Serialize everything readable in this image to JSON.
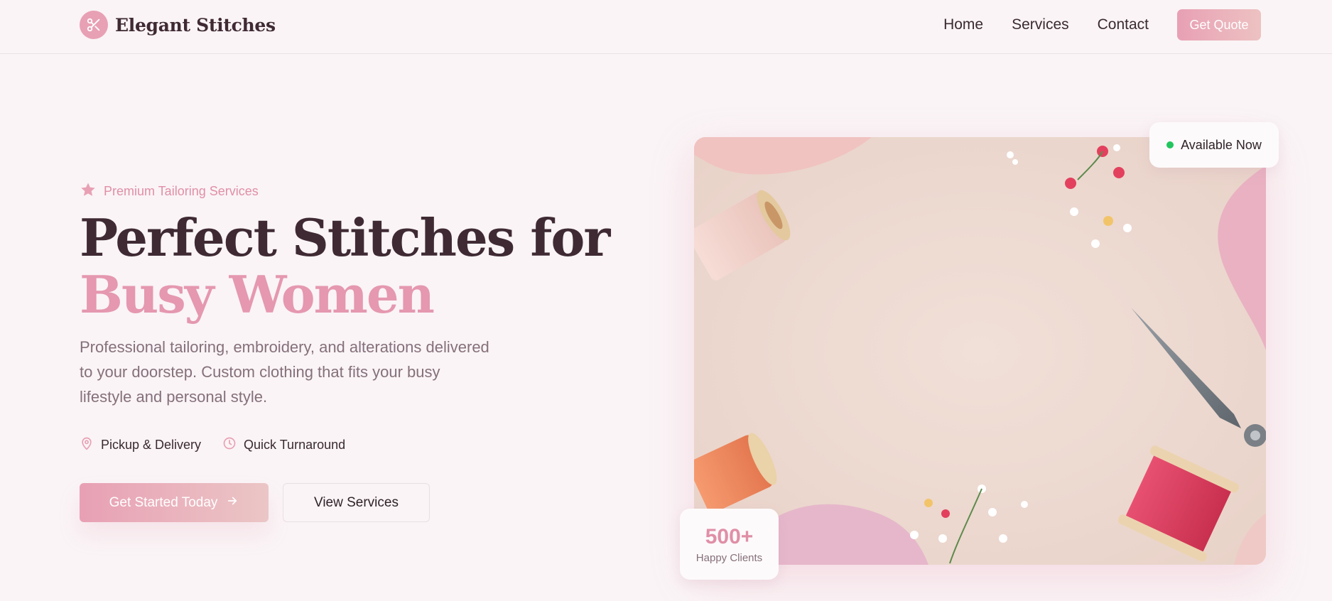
{
  "header": {
    "brand": "Elegant Stitches",
    "brand_icon": "scissors-icon",
    "nav": [
      "Home",
      "Services",
      "Contact"
    ],
    "cta": "Get Quote"
  },
  "hero": {
    "tagline": "Premium Tailoring Services",
    "tagline_icon": "star-icon",
    "title_line1": "Perfect Stitches for",
    "title_line2": "Busy Women",
    "description": "Professional tailoring, embroidery, and alterations delivered to your doorstep. Custom clothing that fits your busy lifestyle and personal style.",
    "features": [
      {
        "label": "Pickup & Delivery",
        "icon": "map-pin-icon"
      },
      {
        "label": "Quick Turnaround",
        "icon": "clock-icon"
      }
    ],
    "primary_cta": "Get Started Today",
    "secondary_cta": "View Services"
  },
  "image_card": {
    "available_badge": "Available Now",
    "clients_count": "500+",
    "clients_label": "Happy Clients"
  },
  "colors": {
    "accent": "#e8a0b4",
    "heading": "#3f2a33",
    "body": "#85707a",
    "background": "#faf4f6",
    "status_green": "#22c55e"
  }
}
